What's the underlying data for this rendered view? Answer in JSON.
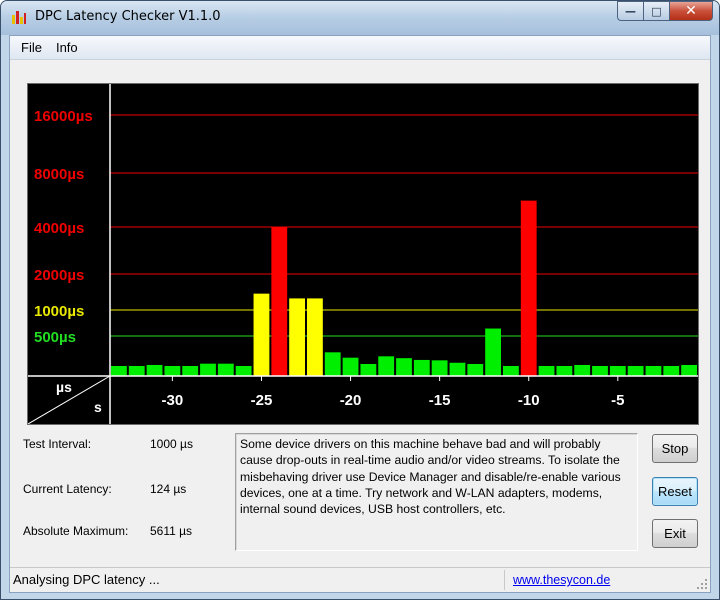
{
  "window": {
    "title": "DPC Latency Checker V1.1.0",
    "caption_min": "—",
    "caption_max": "□",
    "caption_close": "✕"
  },
  "menu": {
    "items": [
      "File",
      "Info"
    ]
  },
  "chart_data": {
    "type": "bar",
    "xlabel": "s",
    "ylabel": "µs",
    "x_ticks": [
      -30,
      -25,
      -20,
      -15,
      -10,
      -5
    ],
    "y_ticks": [
      {
        "label": "500µs",
        "value": 500,
        "color": "#22dd22"
      },
      {
        "label": "1000µs",
        "value": 1000,
        "color": "#e8e800"
      },
      {
        "label": "2000µs",
        "value": 2000,
        "color": "#ee0000"
      },
      {
        "label": "4000µs",
        "value": 4000,
        "color": "#ee0000"
      },
      {
        "label": "8000µs",
        "value": 8000,
        "color": "#ee0000"
      },
      {
        "label": "16000µs",
        "value": 16000,
        "color": "#ee0000"
      }
    ],
    "x": [
      -33,
      -32,
      -31,
      -30,
      -29,
      -28,
      -27,
      -26,
      -25,
      -24,
      -23,
      -22,
      -21,
      -20,
      -19,
      -18,
      -17,
      -16,
      -15,
      -14,
      -13,
      -12,
      -11,
      -10,
      -9,
      -8,
      -7,
      -6,
      -5,
      -4,
      -3,
      -2,
      -1
    ],
    "values": [
      118,
      118,
      124,
      118,
      118,
      132,
      132,
      118,
      1370,
      4000,
      1250,
      1250,
      228,
      176,
      130,
      188,
      172,
      158,
      155,
      138,
      130,
      610,
      118,
      5611,
      118,
      118,
      124,
      118,
      118,
      118,
      118,
      118,
      124
    ],
    "colors": {
      "normal": "#00ee00",
      "warning": "#ffff00",
      "critical": "#ff0000"
    },
    "background": "#000000",
    "grid": true
  },
  "info": {
    "test_interval_label": "Test Interval:",
    "test_interval_value": "1000 µs",
    "current_latency_label": "Current Latency:",
    "current_latency_value": "124 µs",
    "absolute_maximum_label": "Absolute Maximum:",
    "absolute_maximum_value": "5611 µs",
    "message": "Some device drivers on this machine behave bad and will probably cause drop-outs in real-time audio and/or video streams. To isolate the misbehaving driver use Device Manager and disable/re-enable various devices, one at a time. Try network and W-LAN adapters, modems, internal sound devices, USB host controllers, etc."
  },
  "buttons": {
    "stop": "Stop",
    "reset": "Reset",
    "exit": "Exit"
  },
  "status": {
    "text": "Analysing DPC latency ...",
    "link": "www.thesycon.de"
  }
}
